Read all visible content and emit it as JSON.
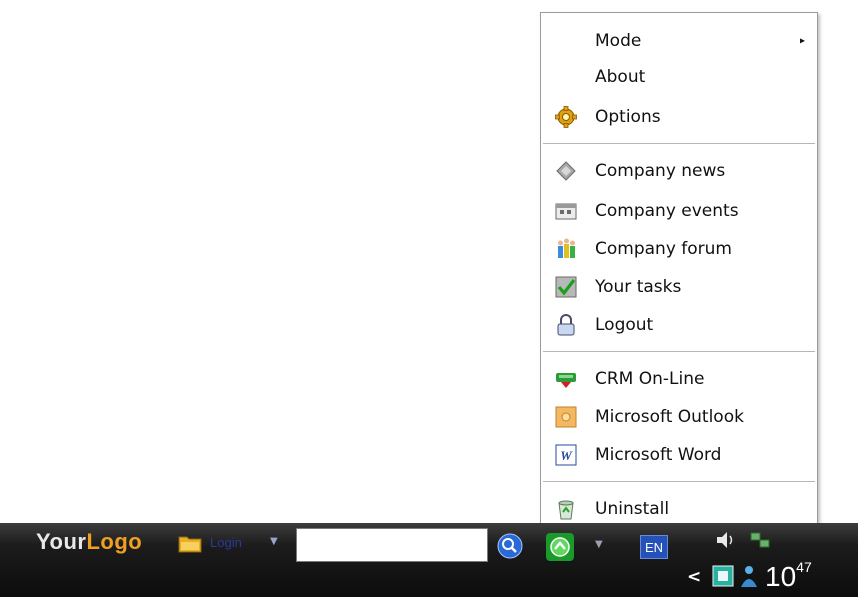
{
  "menu": {
    "items": [
      {
        "label": "Mode",
        "icon": "none",
        "submenu": true
      },
      {
        "label": "About",
        "icon": "none"
      },
      {
        "label": "Options",
        "icon": "gear-icon"
      },
      {
        "label": "Company news",
        "icon": "news-diamond-icon"
      },
      {
        "label": "Company events",
        "icon": "calendar-icon"
      },
      {
        "label": "Company forum",
        "icon": "forum-people-icon"
      },
      {
        "label": "Your tasks",
        "icon": "checkmark-icon"
      },
      {
        "label": "Logout",
        "icon": "padlock-icon"
      },
      {
        "label": "CRM On-Line",
        "icon": "crm-icon"
      },
      {
        "label": "Microsoft Outlook",
        "icon": "outlook-icon"
      },
      {
        "label": "Microsoft Word",
        "icon": "word-icon"
      },
      {
        "label": "Uninstall",
        "icon": "recycle-bin-icon"
      }
    ],
    "submenu_arrow": "▸"
  },
  "taskbar": {
    "logo_part1": "Your",
    "logo_part2": "Logo",
    "login_label": "Login",
    "search_value": "",
    "language": "EN",
    "clock_main": "10",
    "clock_sup": "47"
  },
  "colors": {
    "logo_accent": "#f0a020",
    "lang_badge": "#2552b8"
  }
}
